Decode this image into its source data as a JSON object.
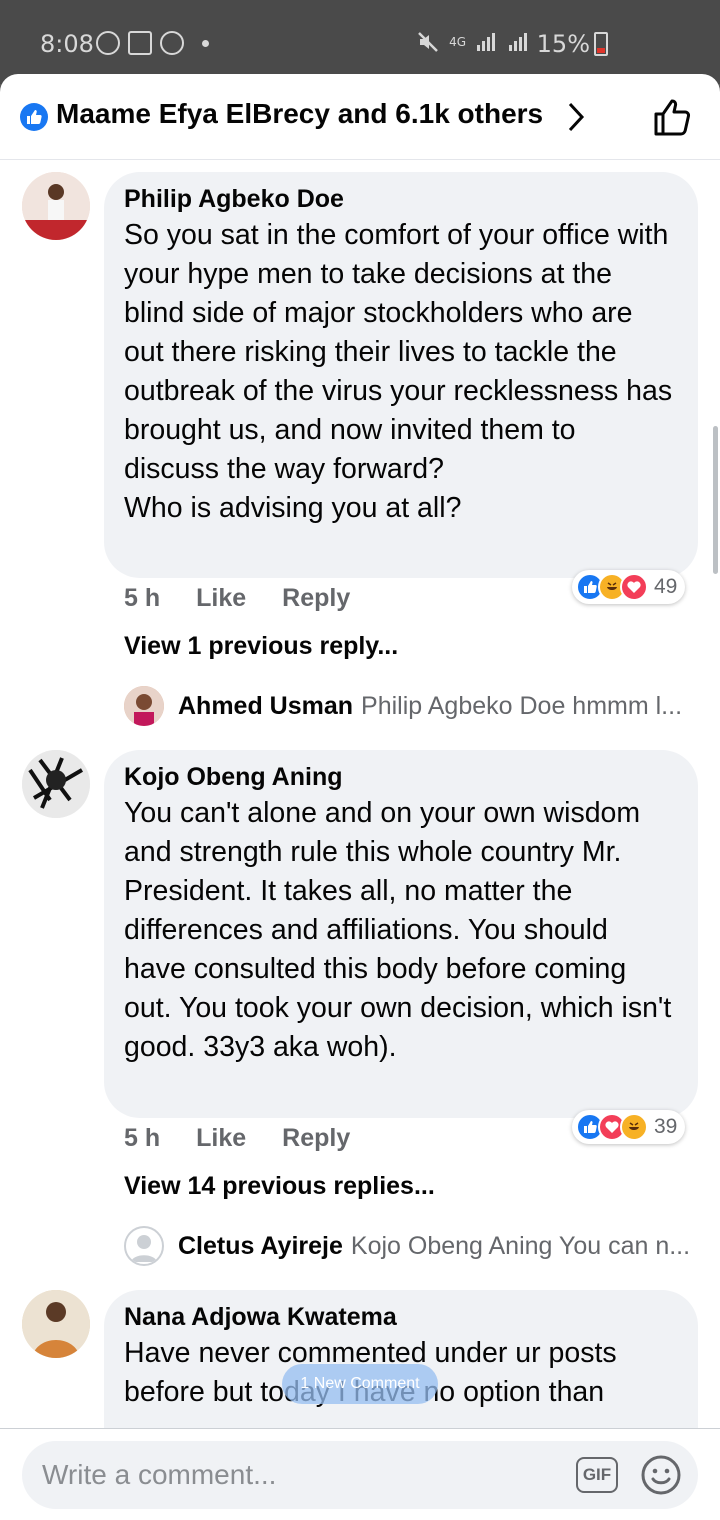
{
  "status_bar": {
    "time": "8:08",
    "network": "4G",
    "battery": "15%"
  },
  "header": {
    "likes_text": "Maame Efya ElBrecy and 6.1k others"
  },
  "comments": [
    {
      "author": "Philip Agbeko Doe",
      "text": "So you sat in the comfort of your office with your hype men to take decisions at the blind side of major stockholders who are out there risking their lives to tackle the outbreak of the virus your recklessness has brought us, and now invited them to discuss the way forward?\nWho is advising you at all?",
      "time": "5 h",
      "like_label": "Like",
      "reply_label": "Reply",
      "reaction_count": "49",
      "view_previous": "View 1 previous reply...",
      "reply": {
        "author": "Ahmed Usman",
        "snippet": "Philip Agbeko Doe hmmm l..."
      }
    },
    {
      "author": "Kojo Obeng Aning",
      "text": "You can't alone and on your own wisdom and strength rule this whole country Mr. President. It takes all, no matter the differences and affiliations. You should have consulted this body before coming out. You took your own decision, which isn't good. 33y3 aka woh).",
      "time": "5 h",
      "like_label": "Like",
      "reply_label": "Reply",
      "reaction_count": "39",
      "view_previous": "View 14 previous replies...",
      "reply": {
        "author": "Cletus Ayireje",
        "snippet": "Kojo Obeng Aning  You can n..."
      }
    },
    {
      "author": "Nana Adjowa Kwatema",
      "text": "Have never commented under ur posts before but today I have no option than"
    }
  ],
  "new_comment_pill": "1 New Comment",
  "composer": {
    "placeholder": "Write a comment...",
    "gif_label": "GIF"
  },
  "colors": {
    "accent": "#1877f2",
    "bubble": "#f0f2f5",
    "love": "#f33e58",
    "haha": "#f7b125"
  }
}
